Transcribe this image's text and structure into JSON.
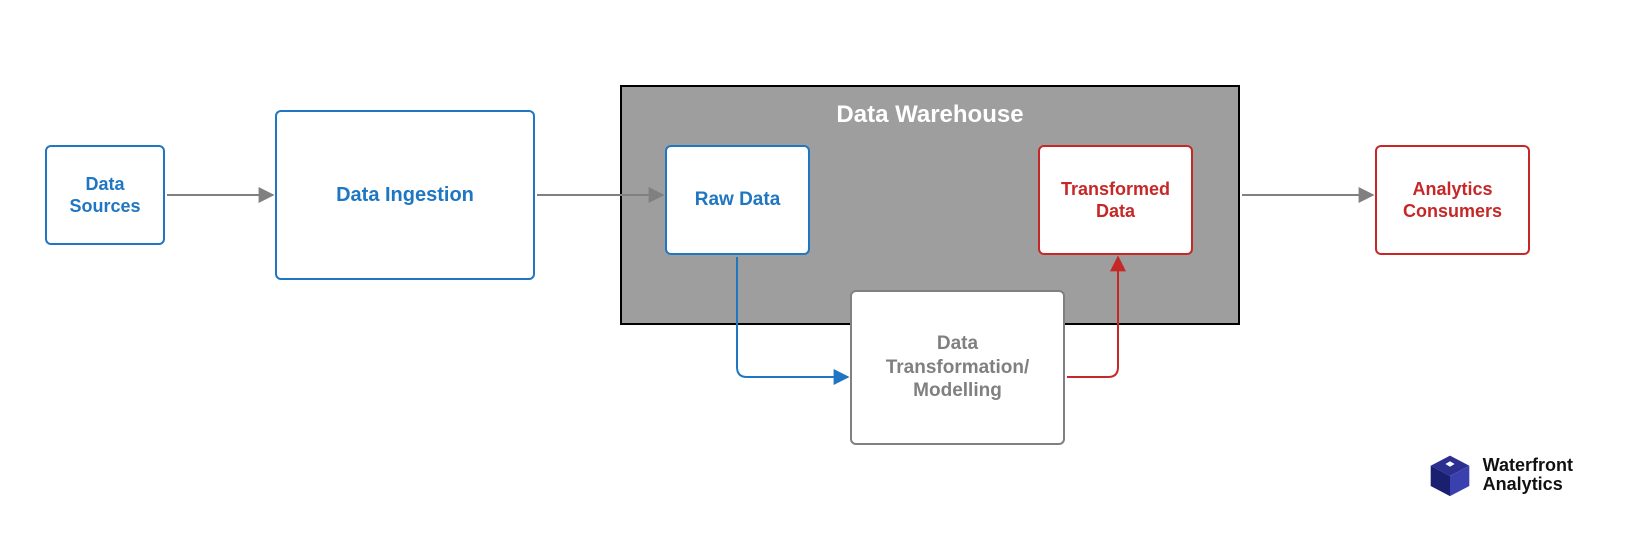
{
  "colors": {
    "blue": "#1f76c2",
    "red": "#c62828",
    "gray": "#808080",
    "arrow_gray": "#808080",
    "warehouse_fill": "#9e9e9e"
  },
  "warehouse": {
    "title": "Data Warehouse"
  },
  "nodes": {
    "data_sources": {
      "label": "Data\nSources"
    },
    "data_ingestion": {
      "label": "Data Ingestion"
    },
    "raw_data": {
      "label": "Raw Data"
    },
    "transformed_data": {
      "label": "Transformed\nData"
    },
    "data_transformation": {
      "label": "Data\nTransformation/\nModelling"
    },
    "analytics_consumers": {
      "label": "Analytics\nConsumers"
    }
  },
  "branding": {
    "name": "Waterfront\nAnalytics"
  },
  "arrows": [
    {
      "from": "data_sources",
      "to": "data_ingestion",
      "color": "gray"
    },
    {
      "from": "data_ingestion",
      "to": "raw_data",
      "color": "gray"
    },
    {
      "from": "raw_data",
      "to": "data_transformation",
      "color": "blue"
    },
    {
      "from": "data_transformation",
      "to": "transformed_data",
      "color": "red"
    },
    {
      "from": "transformed_data",
      "to": "analytics_consumers",
      "color": "gray"
    }
  ]
}
